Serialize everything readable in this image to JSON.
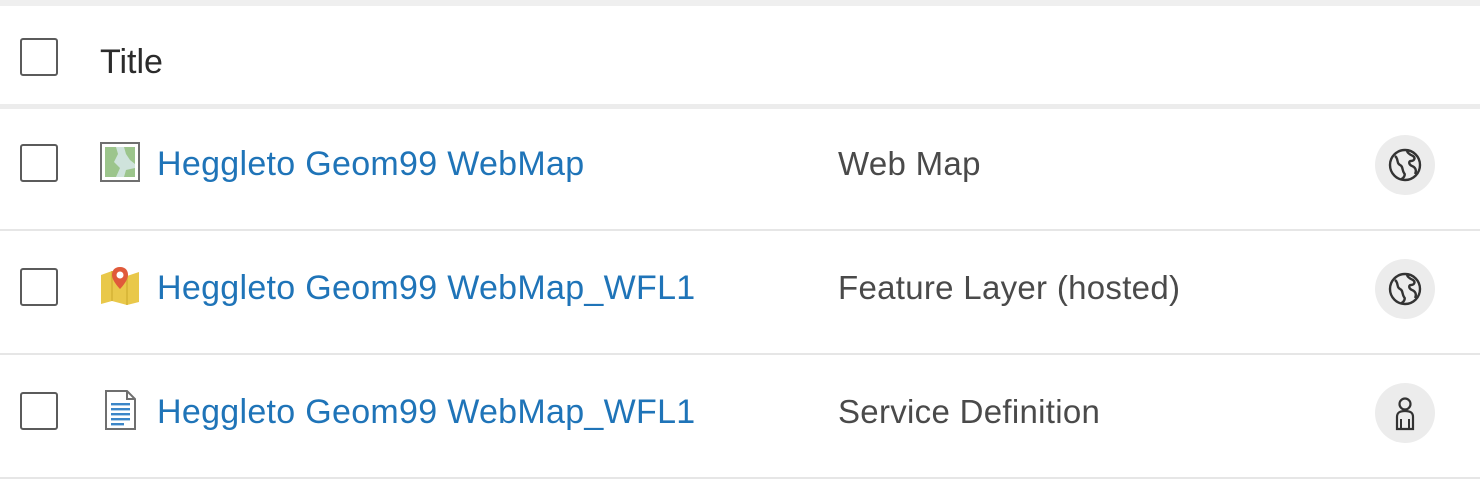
{
  "table": {
    "header": {
      "title_label": "Title"
    },
    "rows": [
      {
        "title": "Heggleto Geom99 WebMap",
        "type": "Web Map",
        "item_icon": "web-map-icon",
        "sharing_icon": "globe-icon"
      },
      {
        "title": "Heggleto Geom99 WebMap_WFL1",
        "type": "Feature Layer (hosted)",
        "item_icon": "feature-layer-icon",
        "sharing_icon": "globe-icon"
      },
      {
        "title": "Heggleto Geom99 WebMap_WFL1",
        "type": "Service Definition",
        "item_icon": "service-definition-icon",
        "sharing_icon": "owner-person-icon"
      }
    ]
  },
  "colors": {
    "link": "#1f74b8",
    "text": "#4a4a4a",
    "divider": "#e6e6e6"
  }
}
